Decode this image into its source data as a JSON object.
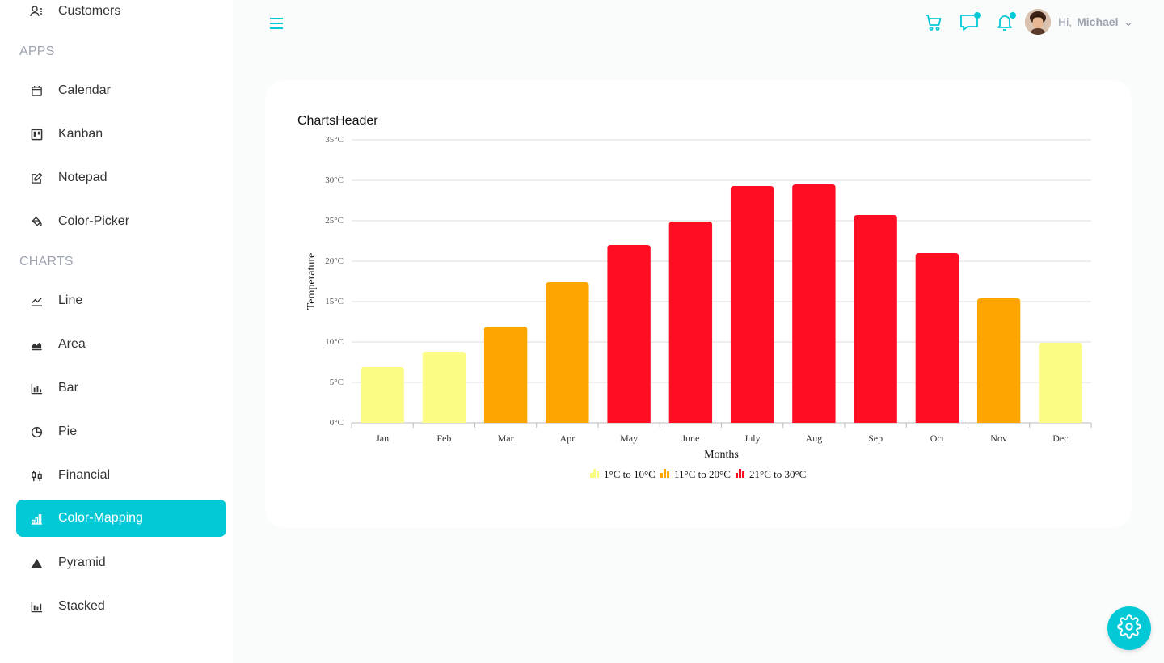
{
  "sidebar": {
    "top_item": {
      "label": "Customers",
      "icon": "customers-icon"
    },
    "sections": [
      {
        "title": "APPS",
        "items": [
          {
            "label": "Calendar",
            "icon": "calendar-icon"
          },
          {
            "label": "Kanban",
            "icon": "kanban-icon"
          },
          {
            "label": "Notepad",
            "icon": "notepad-icon"
          },
          {
            "label": "Color-Picker",
            "icon": "color-picker-icon"
          }
        ]
      },
      {
        "title": "CHARTS",
        "items": [
          {
            "label": "Line",
            "icon": "line-chart-icon"
          },
          {
            "label": "Area",
            "icon": "area-chart-icon"
          },
          {
            "label": "Bar",
            "icon": "bar-chart-icon"
          },
          {
            "label": "Pie",
            "icon": "pie-chart-icon"
          },
          {
            "label": "Financial",
            "icon": "financial-icon"
          },
          {
            "label": "Color-Mapping",
            "icon": "color-mapping-icon",
            "active": true
          },
          {
            "label": "Pyramid",
            "icon": "pyramid-icon"
          },
          {
            "label": "Stacked",
            "icon": "stacked-chart-icon"
          }
        ]
      }
    ]
  },
  "header": {
    "greeting": "Hi,",
    "user_name": "Michael",
    "icons": [
      "menu-icon",
      "cart-icon",
      "chat-icon",
      "notification-icon"
    ]
  },
  "theme": {
    "accent": "#03c9d7",
    "sidebar_bg": "#ffffff",
    "page_bg": "#fafbfb"
  },
  "card": {
    "title": "ChartsHeader"
  },
  "chart_data": {
    "type": "bar",
    "categories": [
      "Jan",
      "Feb",
      "Mar",
      "Apr",
      "May",
      "June",
      "July",
      "Aug",
      "Sep",
      "Oct",
      "Nov",
      "Dec"
    ],
    "values": [
      6.9,
      8.8,
      11.9,
      17.4,
      22,
      24.9,
      29.3,
      29.5,
      25.7,
      21,
      15.4,
      9.9
    ],
    "xlabel": "Months",
    "ylabel": "Temperature",
    "ylim": [
      0,
      35
    ],
    "yticks": [
      "0°C",
      "5°C",
      "10°C",
      "15°C",
      "20°C",
      "25°C",
      "30°C",
      "35°C"
    ],
    "grid": true,
    "legend_position": "bottom",
    "color_ranges": [
      {
        "label": "1°C to 10°C",
        "from": 1,
        "to": 10,
        "color": "#fbfc84"
      },
      {
        "label": "11°C to 20°C",
        "from": 11,
        "to": 20,
        "color": "#ffa500"
      },
      {
        "label": "21°C to 30°C",
        "from": 21,
        "to": 30,
        "color": "#ff0d23"
      }
    ]
  }
}
